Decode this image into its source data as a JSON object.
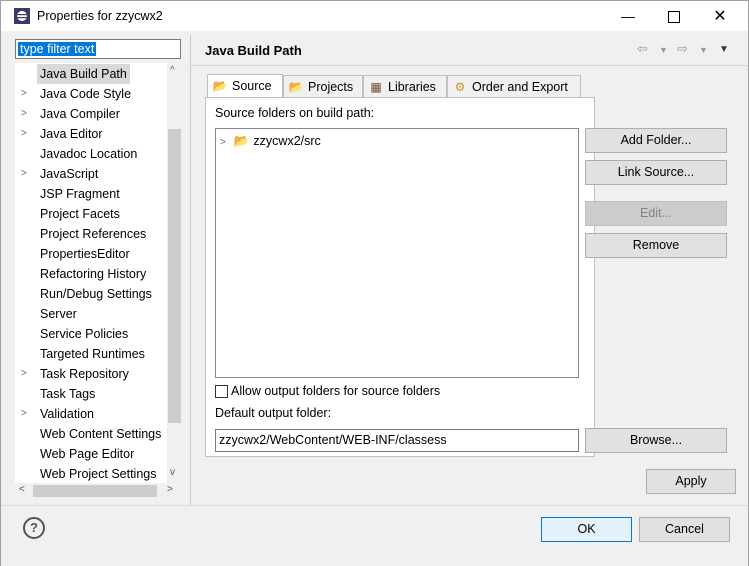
{
  "window": {
    "title": "Properties for zzycwx2",
    "icons": {
      "app": "eclipse-icon",
      "minimize": "minimize-icon",
      "maximize": "maximize-icon",
      "close": "close-icon"
    }
  },
  "filter": {
    "value": "type filter text"
  },
  "tree": {
    "items": [
      {
        "label": "Java Build Path",
        "selected": true,
        "expandable": false
      },
      {
        "label": "Java Code Style",
        "expandable": true
      },
      {
        "label": "Java Compiler",
        "expandable": true
      },
      {
        "label": "Java Editor",
        "expandable": true
      },
      {
        "label": "Javadoc Location",
        "expandable": false
      },
      {
        "label": "JavaScript",
        "expandable": true
      },
      {
        "label": "JSP Fragment",
        "expandable": false
      },
      {
        "label": "Project Facets",
        "expandable": false
      },
      {
        "label": "Project References",
        "expandable": false
      },
      {
        "label": "PropertiesEditor",
        "expandable": false
      },
      {
        "label": "Refactoring History",
        "expandable": false
      },
      {
        "label": "Run/Debug Settings",
        "expandable": false
      },
      {
        "label": "Server",
        "expandable": false
      },
      {
        "label": "Service Policies",
        "expandable": false
      },
      {
        "label": "Targeted Runtimes",
        "expandable": false
      },
      {
        "label": "Task Repository",
        "expandable": true
      },
      {
        "label": "Task Tags",
        "expandable": false
      },
      {
        "label": "Validation",
        "expandable": true
      },
      {
        "label": "Web Content Settings",
        "expandable": false
      },
      {
        "label": "Web Page Editor",
        "expandable": false
      },
      {
        "label": "Web Project Settings",
        "expandable": false
      }
    ]
  },
  "page": {
    "heading": "Java Build Path",
    "tabs": [
      {
        "label": "Source",
        "icon": "source-folder-icon",
        "active": true
      },
      {
        "label": "Projects",
        "icon": "projects-icon",
        "active": false
      },
      {
        "label": "Libraries",
        "icon": "libraries-icon",
        "active": false
      },
      {
        "label": "Order and Export",
        "icon": "order-export-icon",
        "active": false
      }
    ],
    "source_label": "Source folders on build path:",
    "source_folders": [
      {
        "label": "zzycwx2/src",
        "icon": "package-folder-icon"
      }
    ],
    "buttons": {
      "add_folder": "Add Folder...",
      "link_source": "Link Source...",
      "edit": "Edit...",
      "remove": "Remove",
      "browse": "Browse..."
    },
    "allow_output_label": "Allow output folders for source folders",
    "allow_output_checked": false,
    "default_output_label": "Default output folder:",
    "default_output_value": "zzycwx2/WebContent/WEB-INF/classess"
  },
  "footer": {
    "apply": "Apply",
    "ok": "OK",
    "cancel": "Cancel",
    "help_icon": "help-icon"
  },
  "colors": {
    "selection": "#0078d7",
    "accent_border": "#0078d7"
  }
}
